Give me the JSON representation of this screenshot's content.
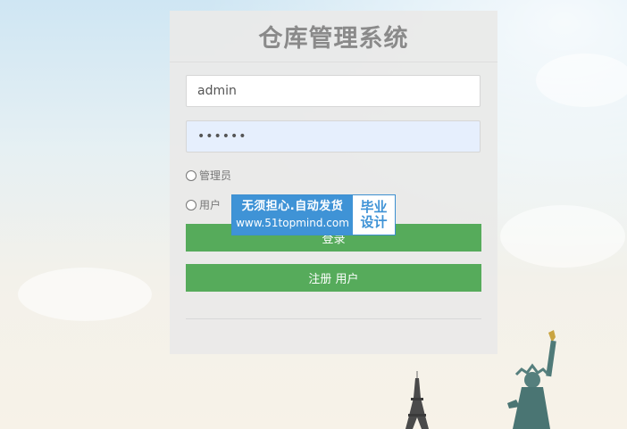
{
  "header": {
    "title": "仓库管理系统"
  },
  "form": {
    "username_value": "admin",
    "password_value": "••••••",
    "roles": [
      {
        "label": "管理员",
        "checked": false
      },
      {
        "label": "用户",
        "checked": false
      }
    ],
    "login_label": "登录",
    "register_label": "注册 用户"
  },
  "watermark": {
    "line1": "无须担心.自动发货",
    "line2": "www.51topmind.com",
    "tag_line1": "毕业",
    "tag_line2": "设计"
  },
  "colors": {
    "button": "#56ab5b",
    "title": "#8a8a8a",
    "badge": "#3f93d6"
  },
  "icons": [
    "radio-icon",
    "eiffel-tower-illustration",
    "statue-of-liberty-illustration"
  ]
}
